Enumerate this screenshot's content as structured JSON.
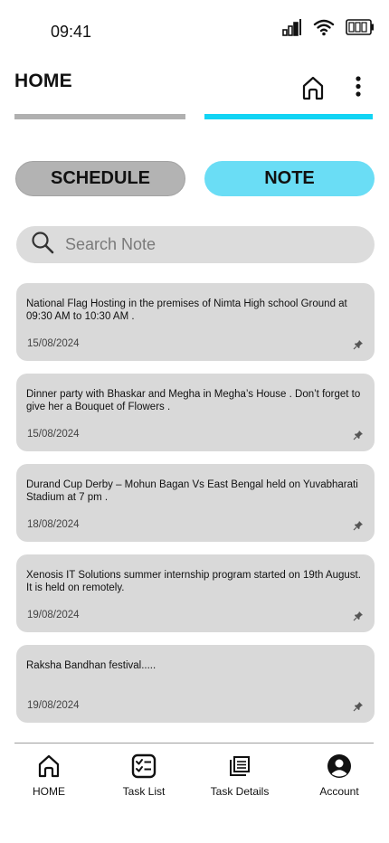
{
  "status_bar": {
    "time": "09:41",
    "icons": [
      "cellular-signal-icon",
      "wifi-icon",
      "battery-icon"
    ]
  },
  "header": {
    "title": "HOME",
    "icons": [
      "home-icon",
      "more-vertical-icon"
    ]
  },
  "tabs": {
    "active_index": 1,
    "colors": {
      "inactive": "#b0b0b0",
      "active": "#12d4f4"
    }
  },
  "segments": [
    {
      "label": "SCHEDULE",
      "active": false,
      "color": "#b3b3b3"
    },
    {
      "label": "NOTE",
      "active": true,
      "color": "#6addf5"
    }
  ],
  "search": {
    "placeholder": "Search Note",
    "value": "",
    "icon": "search-icon"
  },
  "notes": [
    {
      "text": "National Flag Hosting in the premises of Nimta High school Ground at 09:30 AM to 10:30 AM .",
      "date": "15/08/2024",
      "icon": "pin-icon"
    },
    {
      "text": "Dinner party with Bhaskar and Megha in Megha’s House . Don’t forget to give her a Bouquet of Flowers .",
      "date": "15/08/2024",
      "icon": "pin-icon"
    },
    {
      "text": "Durand Cup Derby – Mohun Bagan Vs East Bengal held on Yuvabharati Stadium at 7 pm .",
      "date": "18/08/2024",
      "icon": "pin-icon"
    },
    {
      "text": "Xenosis IT Solutions summer internship program started on 19th August. It is held on remotely.",
      "date": "19/08/2024",
      "icon": "pin-icon"
    },
    {
      "text": "Raksha Bandhan festival.....",
      "date": "19/08/2024",
      "icon": "pin-icon"
    }
  ],
  "bottom_nav": [
    {
      "label": "HOME",
      "icon": "home-icon"
    },
    {
      "label": "Task List",
      "icon": "task-list-icon"
    },
    {
      "label": "Task Details",
      "icon": "task-details-icon"
    },
    {
      "label": "Account",
      "icon": "account-icon"
    }
  ]
}
